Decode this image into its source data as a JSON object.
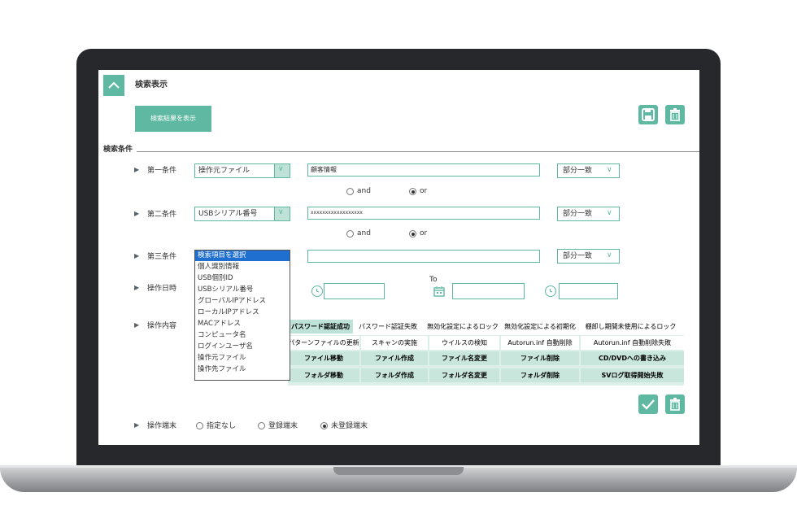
{
  "header": {
    "title": "検索表示",
    "show_results_button": "検索結果を表示"
  },
  "conditions_section_label": "検索条件",
  "rows": [
    {
      "label": "第一条件",
      "field": "操作元ファイル",
      "value": "顧客情報",
      "match": "部分一致"
    },
    {
      "label": "第二条件",
      "field": "USBシリアル番号",
      "value": "xxxxxxxxxxxxxxxxxx",
      "match": "部分一致"
    },
    {
      "label": "第三条件",
      "field": "検索項目を選択",
      "value": "",
      "match": "部分一致"
    }
  ],
  "logic": {
    "and": "and",
    "or": "or",
    "selected": "or"
  },
  "dropdown_options": [
    "検索項目を選択",
    "個人識別情報",
    "USB個別ID",
    "USBシリアル番号",
    "グローバルIPアドレス",
    "ローカルIPアドレス",
    "MACアドレス",
    "コンピュータ名",
    "ログインユーザ名",
    "操作元ファイル",
    "操作先ファイル"
  ],
  "datetime": {
    "label": "操作日時",
    "to_label": "To"
  },
  "operation": {
    "label": "操作内容",
    "row1": [
      "パスワード認証成功",
      "パスワード認証失敗",
      "無効化設定によるロック",
      "無効化設定による初期化",
      "棚卸し期間未使用によるロック"
    ],
    "row2": [
      "パターンファイルの更新",
      "スキャンの実施",
      "ウイルスの検知",
      "Autorun.inf 自動削除",
      "Autorun.inf 自動削除失敗"
    ],
    "row3": [
      "ファイル移動",
      "ファイル作成",
      "ファイル名変更",
      "ファイル削除",
      "CD/DVDへの書き込み"
    ],
    "row4": [
      "フォルダ移動",
      "フォルダ作成",
      "フォルダ名変更",
      "フォルダ削除",
      "SVログ取得開始失敗"
    ]
  },
  "terminal": {
    "label": "操作端末",
    "options": [
      "指定なし",
      "登録端末",
      "未登録端末"
    ],
    "selected": "未登録端末"
  },
  "colors": {
    "accent": "#5fb8a2",
    "accent_light": "#bfe2d8",
    "bezel": "#26282b"
  }
}
